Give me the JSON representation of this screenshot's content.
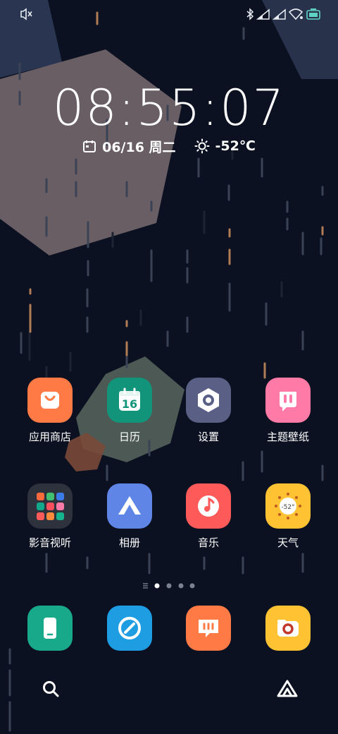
{
  "status_bar": {
    "icons": [
      "mute-icon",
      "bluetooth-icon",
      "signal-1-icon",
      "signal-2-icon",
      "wifi-icon",
      "battery-icon"
    ],
    "battery_color": "#5fd2c4"
  },
  "lockscreen": {
    "time": "08:55:07",
    "date": "06/16 周二",
    "temperature": "-52℃"
  },
  "home": {
    "row1": [
      {
        "label": "应用商店",
        "icon": "app-store-icon",
        "color": "#ff7a45"
      },
      {
        "label": "日历",
        "icon": "calendar-icon",
        "color": "#12947a",
        "icon_text": "16"
      },
      {
        "label": "设置",
        "icon": "settings-icon",
        "color": "#5a5f86"
      },
      {
        "label": "主题壁纸",
        "icon": "themes-icon",
        "color": "#ff7aa6"
      }
    ],
    "row2": [
      {
        "label": "影音视听",
        "icon": "folder-icon",
        "color": "#2d323d"
      },
      {
        "label": "相册",
        "icon": "gallery-icon",
        "color": "#5f86e6"
      },
      {
        "label": "音乐",
        "icon": "music-icon",
        "color": "#ff5a5a"
      },
      {
        "label": "天气",
        "icon": "weather-icon",
        "color": "#ffc233",
        "icon_text": "-52°"
      }
    ],
    "pages": {
      "count": 4,
      "current": 1
    }
  },
  "dock": [
    {
      "icon": "phone-icon",
      "color": "#17a98a"
    },
    {
      "icon": "browser-icon",
      "color": "#1e9de3"
    },
    {
      "icon": "messages-icon",
      "color": "#ff7a45"
    },
    {
      "icon": "camera-icon",
      "color": "#ffc233"
    }
  ],
  "bottom_bar": {
    "left_icon": "search-icon",
    "right_icon": "assistant-icon"
  }
}
